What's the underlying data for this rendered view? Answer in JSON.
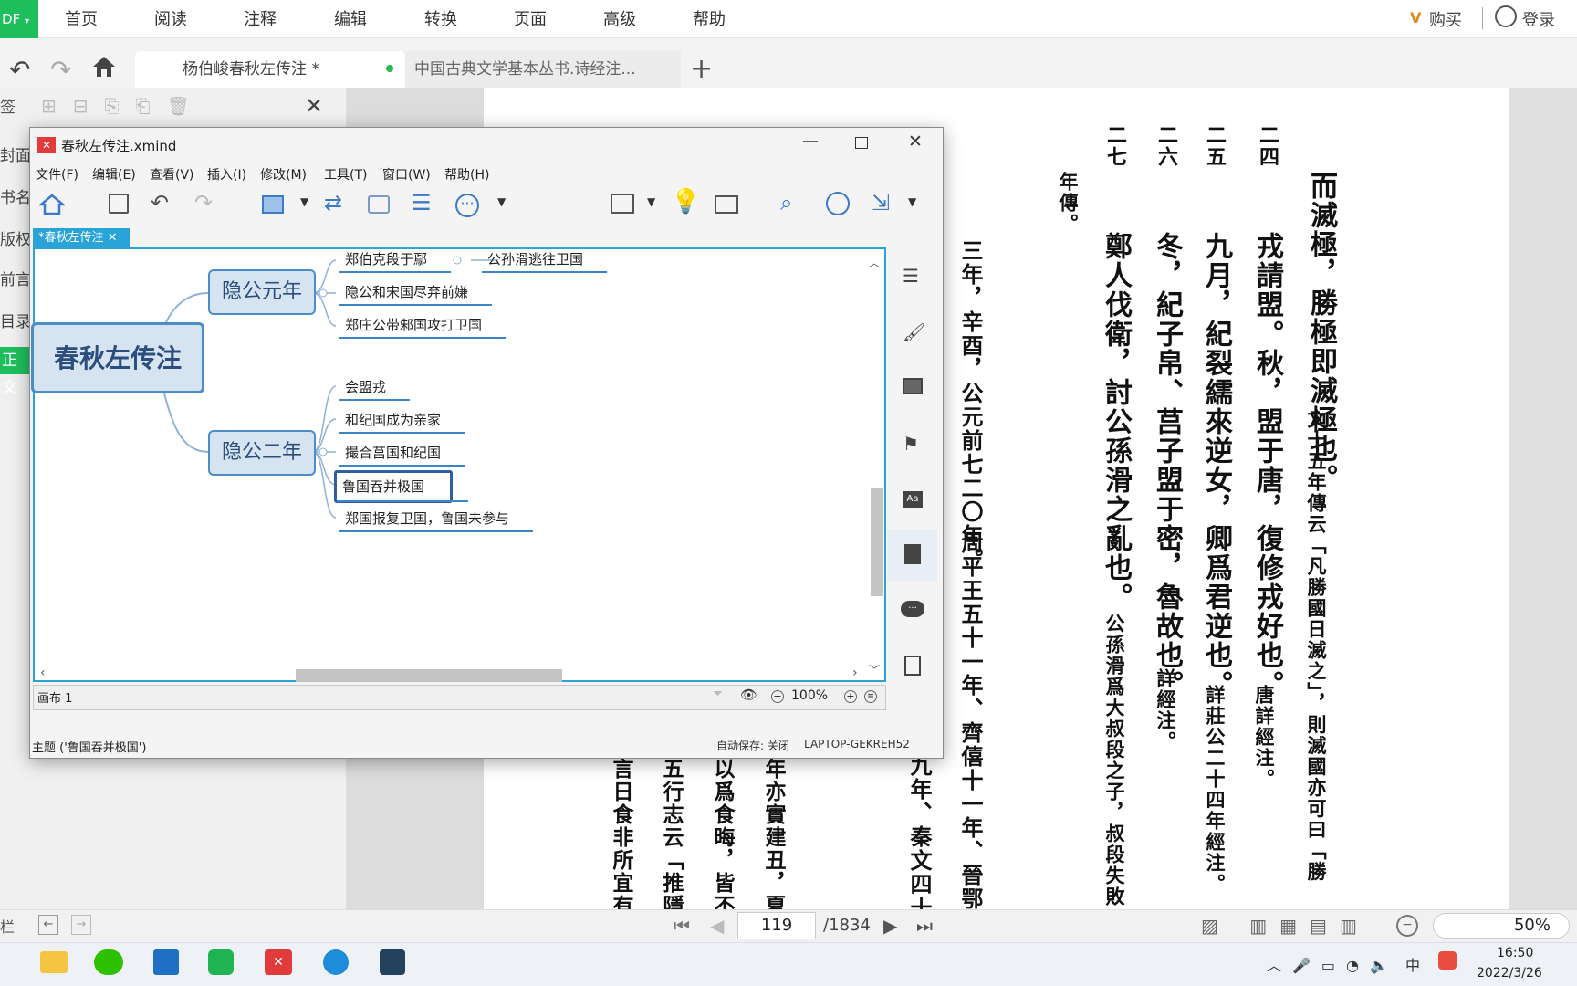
{
  "pdf_app": {
    "logo_text": "DF",
    "menu": [
      "首页",
      "阅读",
      "注释",
      "编辑",
      "转换",
      "页面",
      "高级",
      "帮助"
    ],
    "vip_label": "购买",
    "login_label": "登录",
    "tabs": [
      {
        "label": "杨伯峻春秋左传注 *"
      },
      {
        "label": "中国古典文学基本丛书.诗经注..."
      }
    ],
    "new_tab": "+",
    "sidebar_items": [
      "签",
      "封面",
      "书名",
      "版权",
      "前言",
      "目录",
      "正文"
    ],
    "page_current": "119",
    "page_total": "/1834",
    "zoom": "50%"
  },
  "pdf_text": {
    "col1_big": "而滅極，勝極即滅極也。",
    "col1_small": "文十五年傳云「凡勝國日滅之」，則滅國亦可曰「勝",
    "col2_note": "二四",
    "col2_big": "戎請盟。秋，盟于唐，復修戎好也。",
    "col2_small": "唐詳經注。",
    "col3_note": "二五",
    "col3_big": "九月，紀裂繻來逆女，卿爲君逆也。",
    "col3_small": "詳莊公二十四年經注。",
    "col4_note": "二六",
    "col4_big": "冬，紀子帛、莒子盟于密，魯故也。",
    "col4_small": "詳經注。",
    "col5_note": "二七",
    "col5_big": "鄭人伐衛，討公孫滑之亂也。",
    "col5_small": "公孫滑爲大叔段之子，叔段失敗",
    "col6_small": "年傳。",
    "col7_big": "三年，辛酉，公元前七二〇年。",
    "col7_mid": "周平王五十一年、齊僖十一年、晉鄂四年、",
    "col8_mid": "九年、秦文四十",
    "lower_cols": [
      "年亦實建丑，夏正",
      "以爲食晦，皆不",
      "五行志云「推隱",
      "言日食非所宜有"
    ]
  },
  "xmind": {
    "title": "春秋左传注.xmind",
    "menu": [
      "文件(F)",
      "编辑(E)",
      "查看(V)",
      "插入(I)",
      "修改(M)",
      "工具(T)",
      "窗口(W)",
      "帮助(H)"
    ],
    "sheet_tab": "*春秋左传注",
    "central_topic": "春秋左传注",
    "main_topics": [
      "隐公元年",
      "隐公二年"
    ],
    "subtopics_1": [
      "郑伯克段于鄢",
      "隐公和宋国尽弃前嫌",
      "郑庄公带邾国攻打卫国"
    ],
    "sub_child": "公孙滑逃往卫国",
    "subtopics_2": [
      "会盟戎",
      "和纪国成为亲家",
      "撮合莒国和纪国",
      "鲁国吞并极国",
      "郑国报复卫国，鲁国未参与"
    ],
    "sheet_name": "画布 1",
    "zoom": "100%",
    "status_left": "主题 ('鲁国吞并极国')",
    "autosave": "自动保存: 关闭",
    "computer": "LAPTOP-GEKREH52"
  },
  "taskbar": {
    "time": "16:50",
    "date": "2022/3/26",
    "ime": "中"
  },
  "colors": {
    "accent_green": "#1fbe5c",
    "xmind_blue": "#2aa4d8",
    "topic_border": "#4c8cc8"
  }
}
